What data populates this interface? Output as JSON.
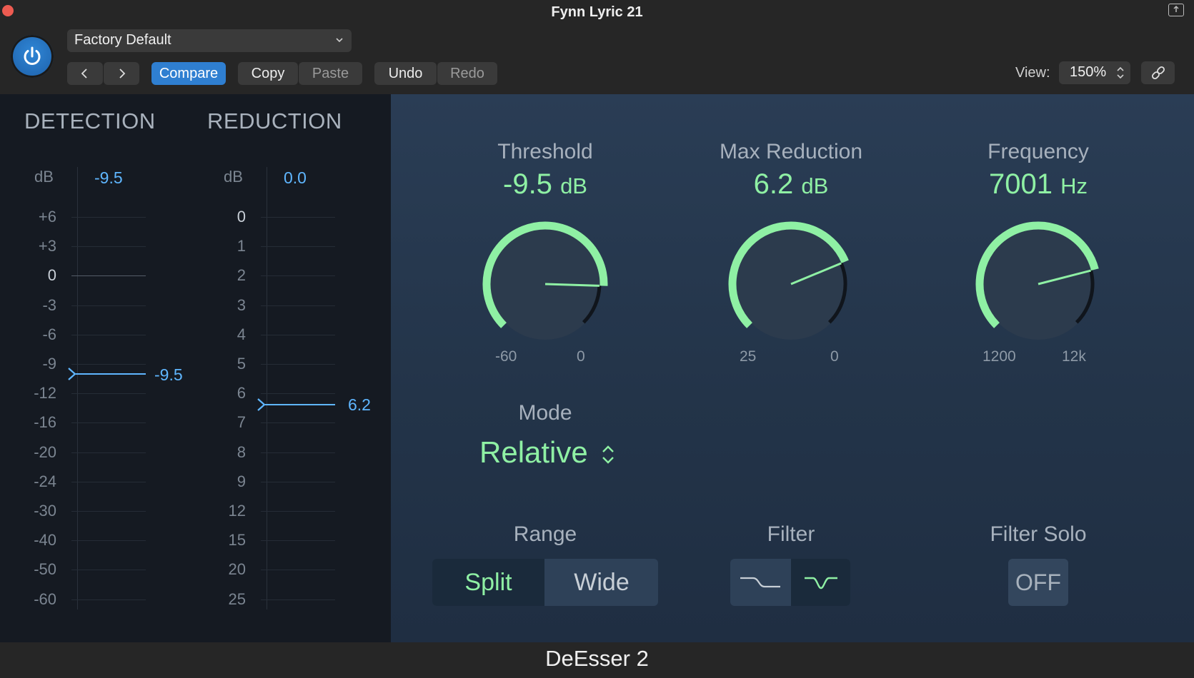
{
  "window": {
    "title": "Fynn Lyric 21"
  },
  "toolbar": {
    "preset": "Factory Default",
    "compare": "Compare",
    "copy": "Copy",
    "paste": "Paste",
    "undo": "Undo",
    "redo": "Redo",
    "view_label": "View:",
    "view_value": "150%"
  },
  "detection": {
    "heading": "DETECTION",
    "db_label": "dB",
    "peak": "-9.5",
    "marker_value": "-9.5",
    "ticks": [
      "+6",
      "+3",
      "0",
      "-3",
      "-6",
      "-9",
      "-12",
      "-16",
      "-20",
      "-24",
      "-30",
      "-40",
      "-50",
      "-60"
    ]
  },
  "reduction": {
    "heading": "REDUCTION",
    "db_label": "dB",
    "peak": "0.0",
    "marker_value": "6.2",
    "ticks": [
      "0",
      "1",
      "2",
      "3",
      "4",
      "5",
      "6",
      "7",
      "8",
      "9",
      "12",
      "15",
      "20",
      "25"
    ]
  },
  "knobs": {
    "threshold": {
      "label": "Threshold",
      "value": "-9.5",
      "unit": "dB",
      "min": "-60",
      "max": "0",
      "fraction": 0.84
    },
    "max_reduction": {
      "label": "Max Reduction",
      "value": "6.2",
      "unit": "dB",
      "min": "25",
      "max": "0",
      "fraction": 0.75
    },
    "frequency": {
      "label": "Frequency",
      "value": "7001",
      "unit": "Hz",
      "min": "1200",
      "max": "12k",
      "fraction": 0.78
    }
  },
  "mode": {
    "label": "Mode",
    "value": "Relative"
  },
  "range": {
    "label": "Range",
    "options": [
      "Split",
      "Wide"
    ],
    "selected": "Split"
  },
  "filter": {
    "label": "Filter",
    "selected": "bell"
  },
  "filter_solo": {
    "label": "Filter Solo",
    "value": "OFF"
  },
  "footer": {
    "title": "DeEsser 2"
  },
  "colors": {
    "accent_green": "#8ff0a4",
    "meter_blue": "#5fb6ff",
    "power_blue": "#2f7fd1"
  }
}
